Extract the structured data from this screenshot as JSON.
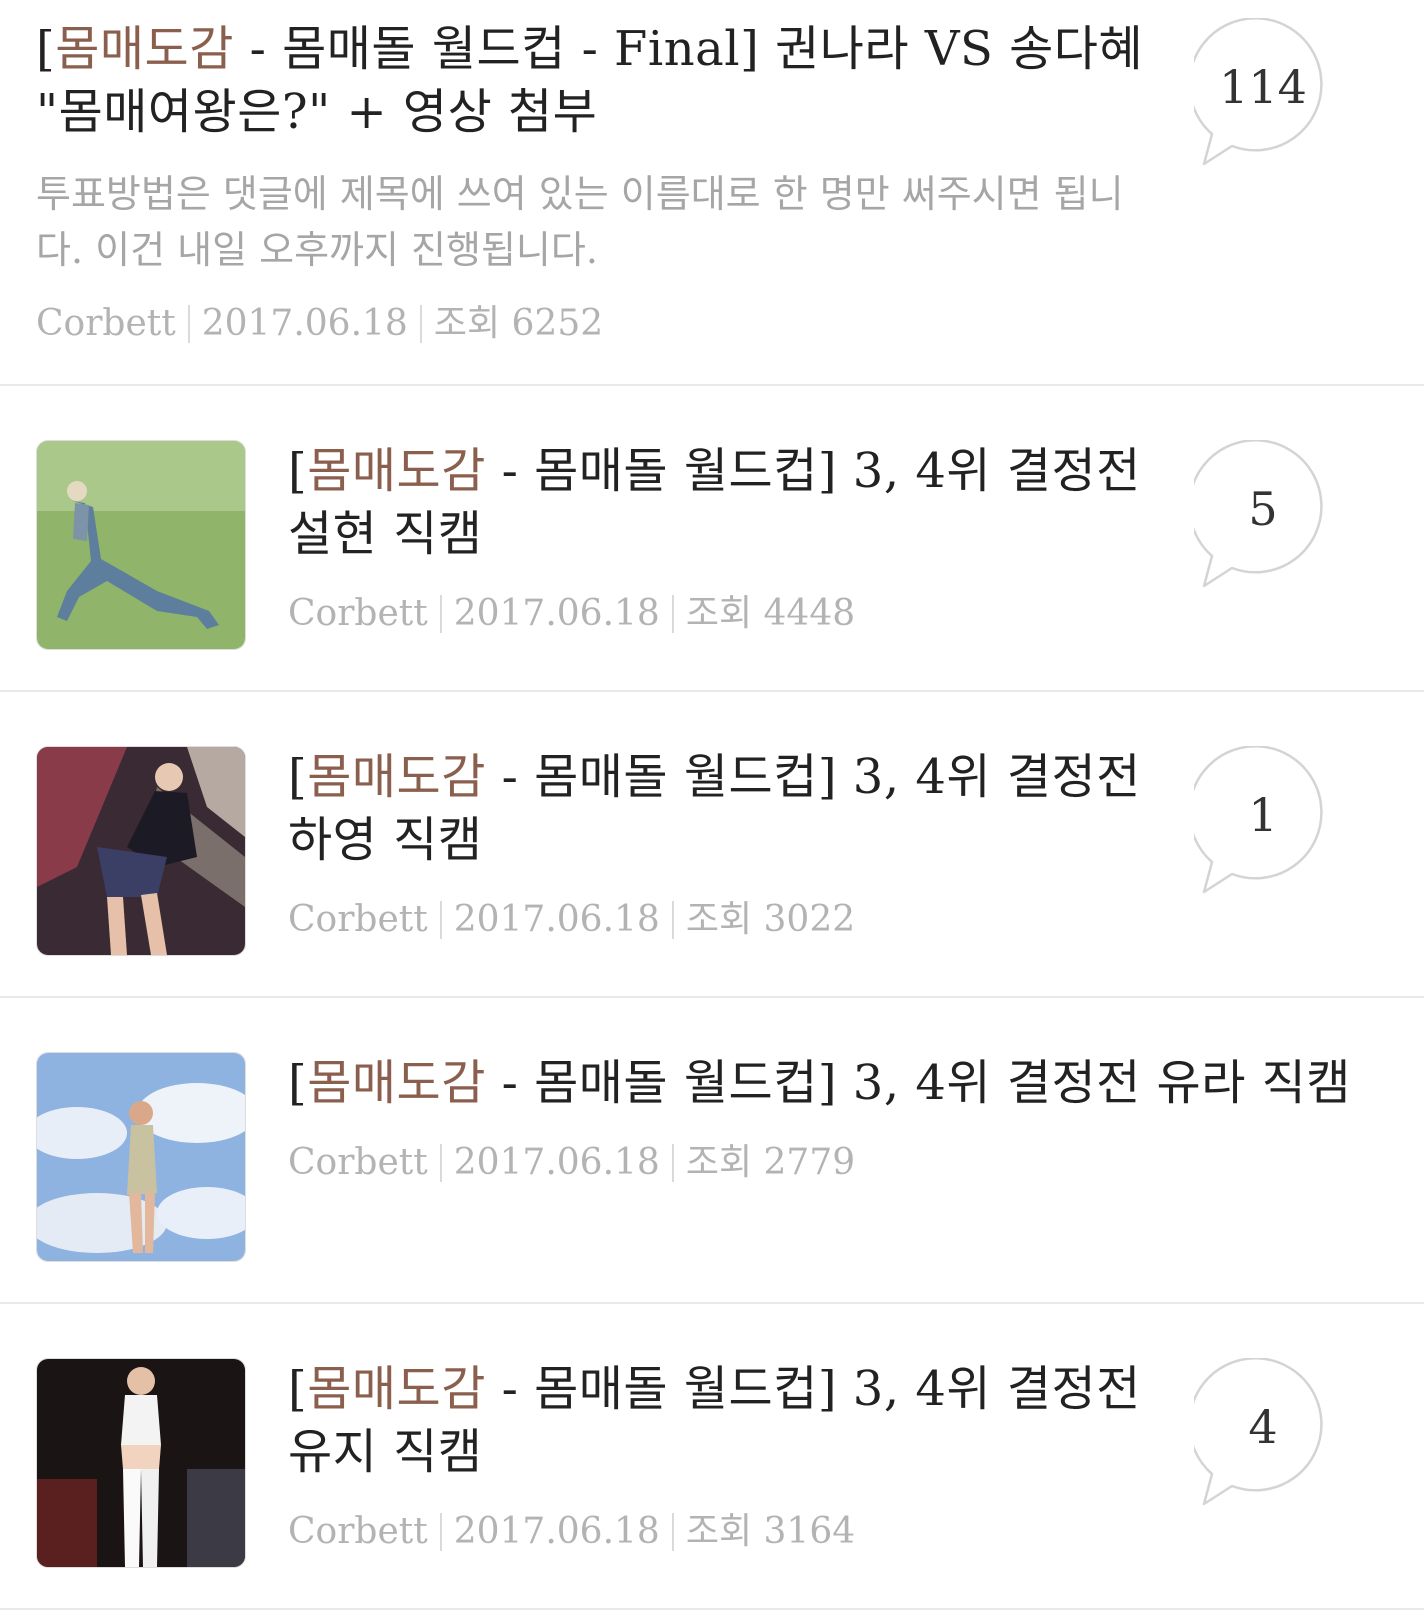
{
  "colors": {
    "category": "#8b5f4e",
    "meta_text": "#b3b3b3",
    "preview_text": "#a6a6a6",
    "divider": "#e9e9e9"
  },
  "posts": [
    {
      "category": "몸매도감",
      "title_rest": " - 몸매돌 월드컵 - Final] 권나라 VS 송다혜 \"몸매여왕은?\" + 영상 첨부",
      "preview": "투표방법은 댓글에 제목에 쓰여 있는 이름대로 한 명만 써주시면 됩니다. 이건 내일 오후까지 진행됩니다.",
      "author": "Corbett",
      "date": "2017.06.18",
      "views_label": "조회 6252",
      "comments": "114"
    },
    {
      "category": "몸매도감",
      "title_rest": " - 몸매돌 월드컵] 3, 4위 결정전 설현 직캠",
      "author": "Corbett",
      "date": "2017.06.18",
      "views_label": "조회 4448",
      "comments": "5",
      "thumb_icon": "photo-thumbnail-icon"
    },
    {
      "category": "몸매도감",
      "title_rest": " - 몸매돌 월드컵] 3, 4위 결정전 하영 직캠",
      "author": "Corbett",
      "date": "2017.06.18",
      "views_label": "조회 3022",
      "comments": "1",
      "thumb_icon": "photo-thumbnail-icon"
    },
    {
      "category": "몸매도감",
      "title_rest": " - 몸매돌 월드컵] 3, 4위 결정전 유라 직캠",
      "author": "Corbett",
      "date": "2017.06.18",
      "views_label": "조회 2779",
      "thumb_icon": "photo-thumbnail-icon"
    },
    {
      "category": "몸매도감",
      "title_rest": " - 몸매돌 월드컵] 3, 4위 결정전 유지 직캠",
      "author": "Corbett",
      "date": "2017.06.18",
      "views_label": "조회 3164",
      "comments": "4",
      "thumb_icon": "photo-thumbnail-icon"
    }
  ]
}
